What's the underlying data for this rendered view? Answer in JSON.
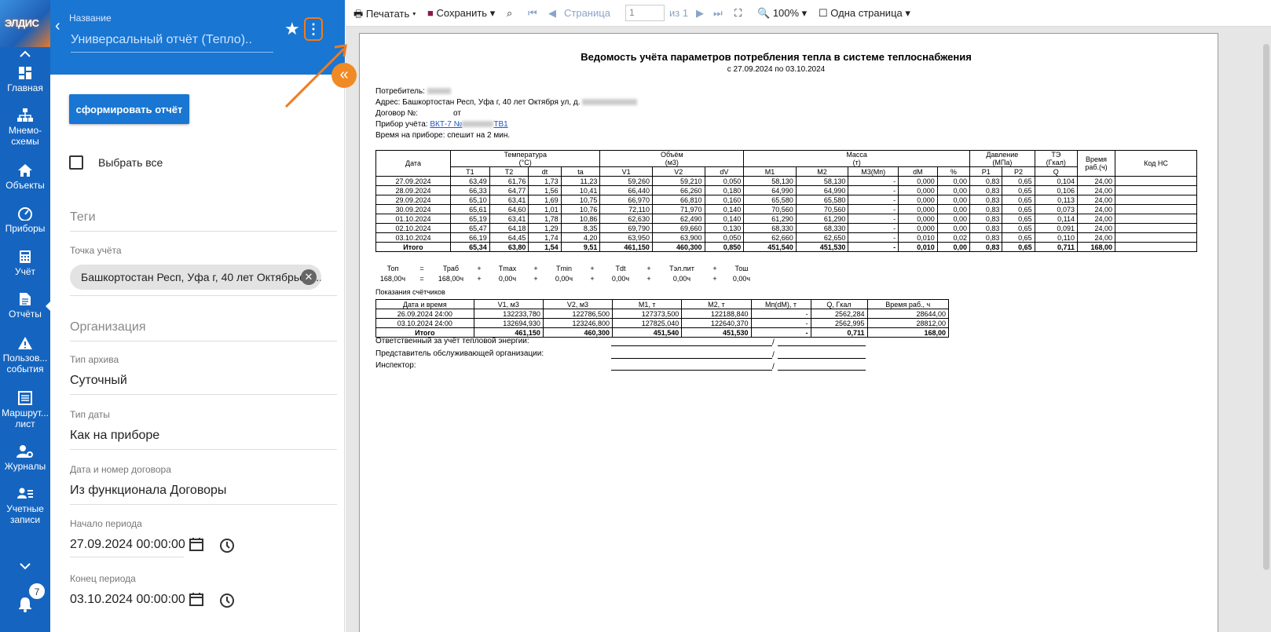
{
  "nav": {
    "logo": "ЭЛДИС",
    "items": [
      {
        "label": "Главная"
      },
      {
        "label": "Мнемо-схемы"
      },
      {
        "label": "Объекты"
      },
      {
        "label": "Приборы"
      },
      {
        "label": "Учёт"
      },
      {
        "label": "Отчёты"
      },
      {
        "label": "Пользов... события"
      },
      {
        "label": "Маршрут... лист"
      },
      {
        "label": "Журналы"
      },
      {
        "label": "Учетные записи"
      }
    ],
    "notifications": "7"
  },
  "panel": {
    "name_label": "Название",
    "name_value": "Универсальный отчёт (Тепло)..",
    "generate": "сформировать отчёт",
    "select_all": "Выбрать все",
    "tags": "Теги",
    "point_label": "Точка учёта",
    "point_value": "Башкортостан Респ, Уфа г, 40 лет Октябрьско...",
    "org": "Организация",
    "archive_label": "Тип архива",
    "archive_value": "Суточный",
    "date_type_label": "Тип даты",
    "date_type_value": "Как на приборе",
    "contract_label": "Дата и номер договора",
    "contract_value": "Из функционала Договоры",
    "start_label": "Начало периода",
    "start_value": "27.09.2024 00:00:00",
    "end_label": "Конец периода",
    "end_value": "03.10.2024 00:00:00"
  },
  "toolbar": {
    "print": "Печатать",
    "save": "Сохранить",
    "page_label": "Страница",
    "page_value": "1",
    "page_of": "из 1",
    "zoom": "100%",
    "view": "Одна страница"
  },
  "doc": {
    "title": "Ведомость учёта параметров потребления тепла в системе теплоснабжения",
    "period": "с 27.09.2024 по 03.10.2024",
    "consumer": "Потребитель:",
    "address": "Адрес:   Башкортостан Респ, Уфа г, 40 лет Октября ул, д.",
    "contract": "Договор №:",
    "contract_from": "от",
    "device_label": "Прибор учёта:",
    "device_a": "ВКТ-7 №",
    "device_b": "ТВ1",
    "device_time": "Время на приборе:   спешит на 2 мин.",
    "headers": {
      "date": "Дата",
      "temp": "Температура",
      "temp_unit": "(°С)",
      "vol": "Объём",
      "vol_unit": "(м3)",
      "mass": "Масса",
      "mass_unit": "(т)",
      "press": "Давление",
      "press_unit": "(МПа)",
      "te": "ТЭ",
      "te_unit": "(Гкал)",
      "time": "Время раб.(ч)",
      "code": "Код НС",
      "sub": [
        "T1",
        "T2",
        "dt",
        "ta",
        "V1",
        "V2",
        "dV",
        "M1",
        "M2",
        "M3(Мп)",
        "dM",
        "%",
        "P1",
        "P2",
        "Q"
      ]
    },
    "rows": [
      [
        "27.09.2024",
        "63,49",
        "61,76",
        "1,73",
        "11,23",
        "59,260",
        "59,210",
        "0,050",
        "58,130",
        "58,130",
        "-",
        "0,000",
        "0,00",
        "0,83",
        "0,65",
        "0,104",
        "24,00",
        ""
      ],
      [
        "28.09.2024",
        "66,33",
        "64,77",
        "1,56",
        "10,41",
        "66,440",
        "66,260",
        "0,180",
        "64,990",
        "64,990",
        "-",
        "0,000",
        "0,00",
        "0,83",
        "0,65",
        "0,106",
        "24,00",
        ""
      ],
      [
        "29.09.2024",
        "65,10",
        "63,41",
        "1,69",
        "10,75",
        "66,970",
        "66,810",
        "0,160",
        "65,580",
        "65,580",
        "-",
        "0,000",
        "0,00",
        "0,83",
        "0,65",
        "0,113",
        "24,00",
        ""
      ],
      [
        "30.09.2024",
        "65,61",
        "64,60",
        "1,01",
        "10,76",
        "72,110",
        "71,970",
        "0,140",
        "70,560",
        "70,560",
        "-",
        "0,000",
        "0,00",
        "0,83",
        "0,65",
        "0,073",
        "24,00",
        ""
      ],
      [
        "01.10.2024",
        "65,19",
        "63,41",
        "1,78",
        "10,86",
        "62,630",
        "62,490",
        "0,140",
        "61,290",
        "61,290",
        "-",
        "0,000",
        "0,00",
        "0,83",
        "0,65",
        "0,114",
        "24,00",
        ""
      ],
      [
        "02.10.2024",
        "65,47",
        "64,18",
        "1,29",
        "8,35",
        "69,790",
        "69,660",
        "0,130",
        "68,330",
        "68,330",
        "-",
        "0,000",
        "0,00",
        "0,83",
        "0,65",
        "0,091",
        "24,00",
        ""
      ],
      [
        "03.10.2024",
        "66,19",
        "64,45",
        "1,74",
        "4,20",
        "63,950",
        "63,900",
        "0,050",
        "62,660",
        "62,650",
        "-",
        "0,010",
        "0,02",
        "0,83",
        "0,65",
        "0,110",
        "24,00",
        ""
      ]
    ],
    "total": [
      "Итого",
      "65,34",
      "63,80",
      "1,54",
      "9,51",
      "461,150",
      "460,300",
      "0,850",
      "451,540",
      "451,530",
      "-",
      "0,010",
      "0,00",
      "0,83",
      "0,65",
      "0,711",
      "168,00",
      ""
    ],
    "summary_head": [
      "Топ",
      "=",
      "Траб",
      "+",
      "Tmax",
      "+",
      "Tmin",
      "+",
      "Tdt",
      "+",
      "Tэл.пит",
      "+",
      "Тош"
    ],
    "summary_vals": [
      "168,00ч",
      "=",
      "168,00ч",
      "+",
      "0,00ч",
      "+",
      "0,00ч",
      "+",
      "0,00ч",
      "+",
      "0,00ч",
      "+",
      "0,00ч"
    ],
    "counters_title": "Показания счётчиков",
    "c_headers": [
      "Дата и время",
      "V1, м3",
      "V2, м3",
      "M1, т",
      "M2, т",
      "Mп(dM), т",
      "Q, Гкал",
      "Время раб., ч"
    ],
    "c_rows": [
      [
        "26.09.2024 24:00",
        "132233,780",
        "122786,500",
        "127373,500",
        "122188,840",
        "-",
        "2562,284",
        "28644,00"
      ],
      [
        "03.10.2024 24:00",
        "132694,930",
        "123246,800",
        "127825,040",
        "122640,370",
        "-",
        "2562,995",
        "28812,00"
      ]
    ],
    "c_total": [
      "Итого",
      "461,150",
      "460,300",
      "451,540",
      "451,530",
      "-",
      "0,711",
      "168,00"
    ],
    "sig1": "Ответственный за учёт тепловой энергии:",
    "sig2": "Представитель обслуживающей организации:",
    "sig3": "Инспектор:",
    "slash": "/"
  }
}
